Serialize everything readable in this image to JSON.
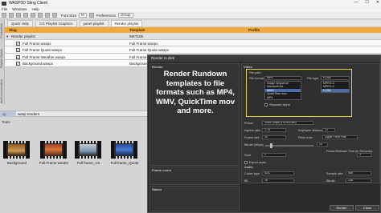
{
  "window": {
    "title": "WASP3D Sting Client",
    "controls": [
      "—",
      "☐",
      "✕"
    ]
  },
  "menu": [
    "File",
    "Windows",
    "Help"
  ],
  "toolbar": {
    "font_size_label": "Font Size",
    "font_size_value": "M",
    "preferences": "Preferences",
    "group": "Group"
  },
  "tabs": [
    "Quick Help",
    "CG Playlist Graphics",
    "panel playlist",
    "Render playlist"
  ],
  "sidebar_labels": [
    "Productions",
    "Playlist Objects",
    "Communication",
    "Aux"
  ],
  "table": {
    "headers": {
      "slug": "Slug",
      "template": "Template",
      "profile": "Profile"
    },
    "rows": [
      {
        "slug": "Render playlist",
        "template": "MKT106",
        "checked": false,
        "indent": 0
      },
      {
        "slug": "Full Frame.waspx",
        "template": "Full Frame.waspx",
        "checked": true,
        "indent": 1
      },
      {
        "slug": "Full Frame Quote.waspx",
        "template": "Full Frame Quote.waspx",
        "checked": true,
        "indent": 1
      },
      {
        "slug": "Full Frame Weather.waspx",
        "template": "Full Frame Weather.waspx",
        "checked": true,
        "indent": 1
      },
      {
        "slug": "Background.waspx",
        "template": "Background.waspx",
        "checked": true,
        "indent": 1
      }
    ]
  },
  "lower": {
    "tab1": "xy",
    "tab2": "wasp renders",
    "tools": "Tools"
  },
  "thumbnails": [
    {
      "label": "Background"
    },
    {
      "label": "Full Frame weater"
    },
    {
      "label": "Full frame_AS"
    },
    {
      "label": "Full frame_Quote"
    }
  ],
  "dialog": {
    "title": "Render to disk",
    "section_render": "Render",
    "section_video": "Video",
    "callout": "Render Rundown templates to file formats such as MP4, WMV, QuickTime mov and more.",
    "file_path": "File path",
    "file_format_label": "File format",
    "file_format_value": "MP4",
    "formats": [
      "Image Sequence",
      "Microsoft Avi",
      "WMV",
      "QuickTime mov",
      "MP4"
    ],
    "selected_format": "WMV",
    "file_type_label": "File type",
    "file_type_value": "H.264",
    "file_types": [
      "MPEG-4",
      "MPEG-2",
      "H.264"
    ],
    "selected_type": "H.264",
    "separate_alpha": "Separate alpha",
    "preset_label": "Preset",
    "preset_value": "1080i 30fps (1920x1080)",
    "aspect_label": "Aspect ratio",
    "aspect_value": "1.78",
    "keyframe_label": "Keyframe distance",
    "keyframe_value": "12",
    "framerate_label": "Frame rate",
    "framerate_value": "25",
    "field_order_label": "Field order",
    "field_order_value": "Upper Field First",
    "bitrate_label": "Bitrate (Mbps)",
    "bitrate_value": "10",
    "start_label": "Start",
    "start_value": "1",
    "pause_label": "Pause/Release Time (in Seconds)",
    "pause_value": "3",
    "frame_count": "Frame count",
    "status": "Status",
    "export_audio": "Export audio",
    "audio_label": "Audio",
    "codec_label": "Codec type",
    "codec_value": "AAC",
    "sample_rate_label": "Sample rate",
    "sample_rate_value": "48K",
    "bit_label": "Bit",
    "bit_value": "16",
    "bitrate_a_label": "Bitrate",
    "bitrate_a_value": "128",
    "render_button": "Render",
    "close_button": "Close"
  },
  "colors": {
    "header_orange": "#f0a83a",
    "highlight_yellow": "#e8d43a",
    "dialog_bg": "#2b2b2b"
  }
}
